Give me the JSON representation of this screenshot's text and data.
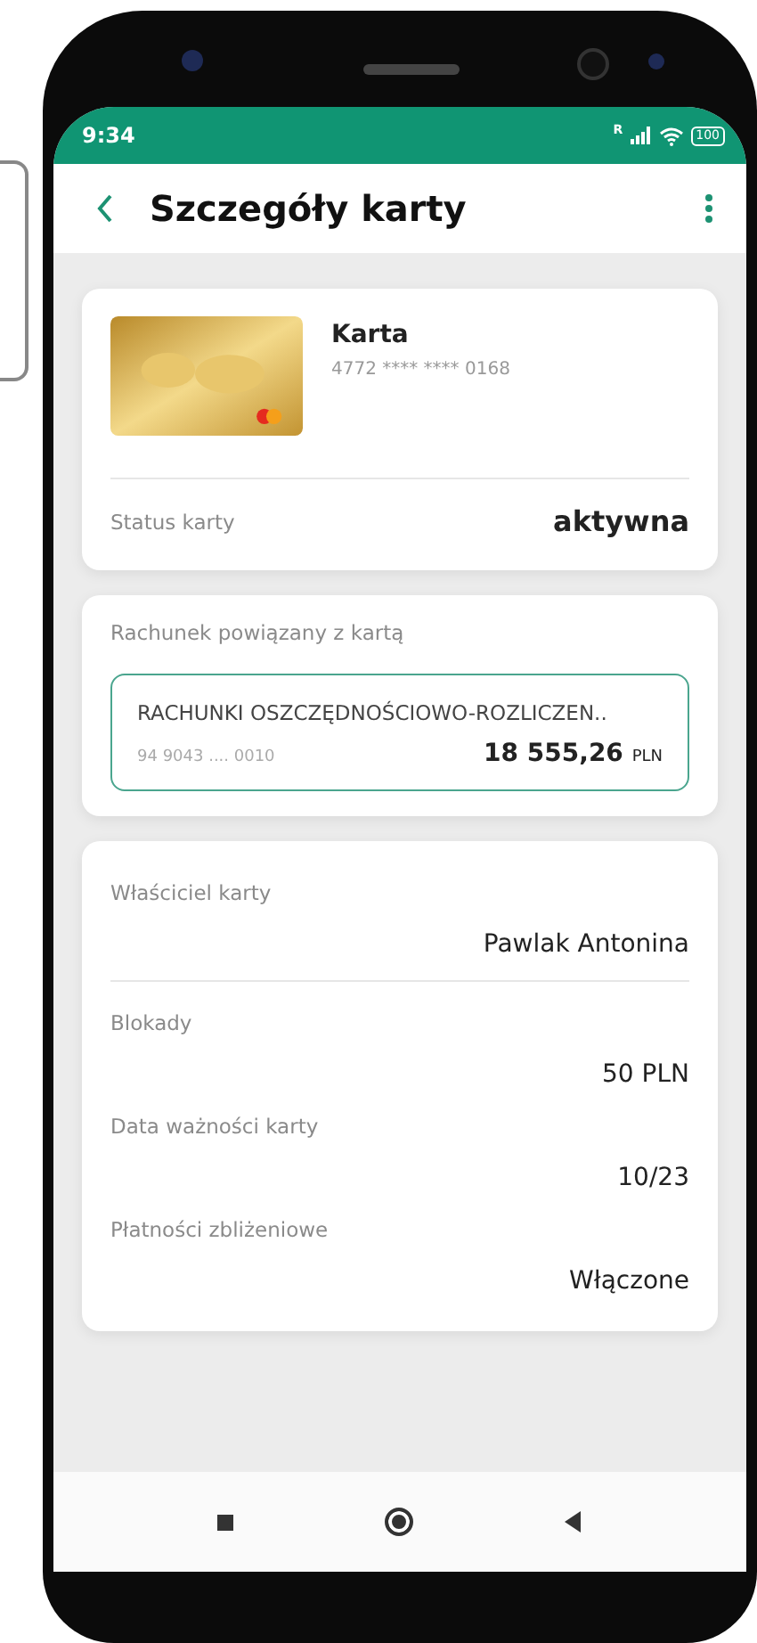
{
  "status_bar": {
    "time": "9:34",
    "roaming": "R",
    "battery": "100"
  },
  "header": {
    "title": "Szczegóły karty"
  },
  "card": {
    "name": "Karta",
    "number": "4772 **** **** 0168",
    "status_label": "Status karty",
    "status_value": "aktywna"
  },
  "account": {
    "heading": "Rachunek powiązany z kartą",
    "name": "RACHUNKI OSZCZĘDNOŚCIOWO-ROZLICZEN..",
    "number": "94 9043 .... 0010",
    "amount": "18 555,26",
    "currency": "PLN"
  },
  "details": [
    {
      "label": "Właściciel karty",
      "value": "Pawlak Antonina",
      "divider": true
    },
    {
      "label": "Blokady",
      "value": "50 PLN",
      "divider": false
    },
    {
      "label": "Data ważności karty",
      "value": "10/23",
      "divider": false
    },
    {
      "label": "Płatności zbliżeniowe",
      "value": "Włączone",
      "divider": false
    }
  ]
}
